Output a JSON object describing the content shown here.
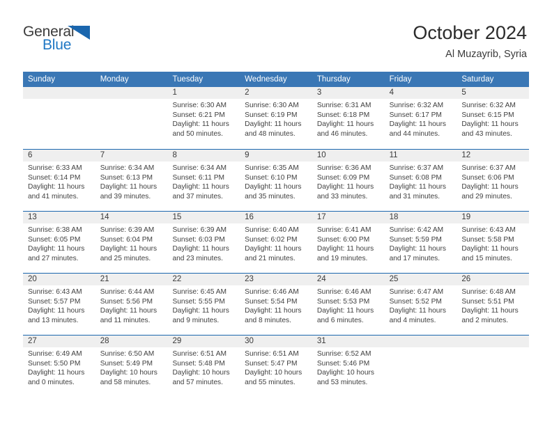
{
  "brand": {
    "name_top": "General",
    "name_bottom": "Blue",
    "triangle_icon": "triangle-logo-icon",
    "color_blue": "#1a66ae",
    "color_text": "#3b3b3b"
  },
  "header": {
    "title": "October 2024",
    "subtitle": "Al Muzayrib, Syria"
  },
  "calendar": {
    "header_bg": "#3a77b5",
    "row_divider": "#1a66ae",
    "date_band_bg": "#efefef",
    "weekdays": [
      "Sunday",
      "Monday",
      "Tuesday",
      "Wednesday",
      "Thursday",
      "Friday",
      "Saturday"
    ],
    "weeks": [
      [
        {
          "day": "",
          "lines": []
        },
        {
          "day": "",
          "lines": []
        },
        {
          "day": "1",
          "lines": [
            "Sunrise: 6:30 AM",
            "Sunset: 6:21 PM",
            "Daylight: 11 hours",
            "and 50 minutes."
          ]
        },
        {
          "day": "2",
          "lines": [
            "Sunrise: 6:30 AM",
            "Sunset: 6:19 PM",
            "Daylight: 11 hours",
            "and 48 minutes."
          ]
        },
        {
          "day": "3",
          "lines": [
            "Sunrise: 6:31 AM",
            "Sunset: 6:18 PM",
            "Daylight: 11 hours",
            "and 46 minutes."
          ]
        },
        {
          "day": "4",
          "lines": [
            "Sunrise: 6:32 AM",
            "Sunset: 6:17 PM",
            "Daylight: 11 hours",
            "and 44 minutes."
          ]
        },
        {
          "day": "5",
          "lines": [
            "Sunrise: 6:32 AM",
            "Sunset: 6:15 PM",
            "Daylight: 11 hours",
            "and 43 minutes."
          ]
        }
      ],
      [
        {
          "day": "6",
          "lines": [
            "Sunrise: 6:33 AM",
            "Sunset: 6:14 PM",
            "Daylight: 11 hours",
            "and 41 minutes."
          ]
        },
        {
          "day": "7",
          "lines": [
            "Sunrise: 6:34 AM",
            "Sunset: 6:13 PM",
            "Daylight: 11 hours",
            "and 39 minutes."
          ]
        },
        {
          "day": "8",
          "lines": [
            "Sunrise: 6:34 AM",
            "Sunset: 6:11 PM",
            "Daylight: 11 hours",
            "and 37 minutes."
          ]
        },
        {
          "day": "9",
          "lines": [
            "Sunrise: 6:35 AM",
            "Sunset: 6:10 PM",
            "Daylight: 11 hours",
            "and 35 minutes."
          ]
        },
        {
          "day": "10",
          "lines": [
            "Sunrise: 6:36 AM",
            "Sunset: 6:09 PM",
            "Daylight: 11 hours",
            "and 33 minutes."
          ]
        },
        {
          "day": "11",
          "lines": [
            "Sunrise: 6:37 AM",
            "Sunset: 6:08 PM",
            "Daylight: 11 hours",
            "and 31 minutes."
          ]
        },
        {
          "day": "12",
          "lines": [
            "Sunrise: 6:37 AM",
            "Sunset: 6:06 PM",
            "Daylight: 11 hours",
            "and 29 minutes."
          ]
        }
      ],
      [
        {
          "day": "13",
          "lines": [
            "Sunrise: 6:38 AM",
            "Sunset: 6:05 PM",
            "Daylight: 11 hours",
            "and 27 minutes."
          ]
        },
        {
          "day": "14",
          "lines": [
            "Sunrise: 6:39 AM",
            "Sunset: 6:04 PM",
            "Daylight: 11 hours",
            "and 25 minutes."
          ]
        },
        {
          "day": "15",
          "lines": [
            "Sunrise: 6:39 AM",
            "Sunset: 6:03 PM",
            "Daylight: 11 hours",
            "and 23 minutes."
          ]
        },
        {
          "day": "16",
          "lines": [
            "Sunrise: 6:40 AM",
            "Sunset: 6:02 PM",
            "Daylight: 11 hours",
            "and 21 minutes."
          ]
        },
        {
          "day": "17",
          "lines": [
            "Sunrise: 6:41 AM",
            "Sunset: 6:00 PM",
            "Daylight: 11 hours",
            "and 19 minutes."
          ]
        },
        {
          "day": "18",
          "lines": [
            "Sunrise: 6:42 AM",
            "Sunset: 5:59 PM",
            "Daylight: 11 hours",
            "and 17 minutes."
          ]
        },
        {
          "day": "19",
          "lines": [
            "Sunrise: 6:43 AM",
            "Sunset: 5:58 PM",
            "Daylight: 11 hours",
            "and 15 minutes."
          ]
        }
      ],
      [
        {
          "day": "20",
          "lines": [
            "Sunrise: 6:43 AM",
            "Sunset: 5:57 PM",
            "Daylight: 11 hours",
            "and 13 minutes."
          ]
        },
        {
          "day": "21",
          "lines": [
            "Sunrise: 6:44 AM",
            "Sunset: 5:56 PM",
            "Daylight: 11 hours",
            "and 11 minutes."
          ]
        },
        {
          "day": "22",
          "lines": [
            "Sunrise: 6:45 AM",
            "Sunset: 5:55 PM",
            "Daylight: 11 hours",
            "and 9 minutes."
          ]
        },
        {
          "day": "23",
          "lines": [
            "Sunrise: 6:46 AM",
            "Sunset: 5:54 PM",
            "Daylight: 11 hours",
            "and 8 minutes."
          ]
        },
        {
          "day": "24",
          "lines": [
            "Sunrise: 6:46 AM",
            "Sunset: 5:53 PM",
            "Daylight: 11 hours",
            "and 6 minutes."
          ]
        },
        {
          "day": "25",
          "lines": [
            "Sunrise: 6:47 AM",
            "Sunset: 5:52 PM",
            "Daylight: 11 hours",
            "and 4 minutes."
          ]
        },
        {
          "day": "26",
          "lines": [
            "Sunrise: 6:48 AM",
            "Sunset: 5:51 PM",
            "Daylight: 11 hours",
            "and 2 minutes."
          ]
        }
      ],
      [
        {
          "day": "27",
          "lines": [
            "Sunrise: 6:49 AM",
            "Sunset: 5:50 PM",
            "Daylight: 11 hours",
            "and 0 minutes."
          ]
        },
        {
          "day": "28",
          "lines": [
            "Sunrise: 6:50 AM",
            "Sunset: 5:49 PM",
            "Daylight: 10 hours",
            "and 58 minutes."
          ]
        },
        {
          "day": "29",
          "lines": [
            "Sunrise: 6:51 AM",
            "Sunset: 5:48 PM",
            "Daylight: 10 hours",
            "and 57 minutes."
          ]
        },
        {
          "day": "30",
          "lines": [
            "Sunrise: 6:51 AM",
            "Sunset: 5:47 PM",
            "Daylight: 10 hours",
            "and 55 minutes."
          ]
        },
        {
          "day": "31",
          "lines": [
            "Sunrise: 6:52 AM",
            "Sunset: 5:46 PM",
            "Daylight: 10 hours",
            "and 53 minutes."
          ]
        },
        {
          "day": "",
          "lines": []
        },
        {
          "day": "",
          "lines": []
        }
      ]
    ]
  }
}
